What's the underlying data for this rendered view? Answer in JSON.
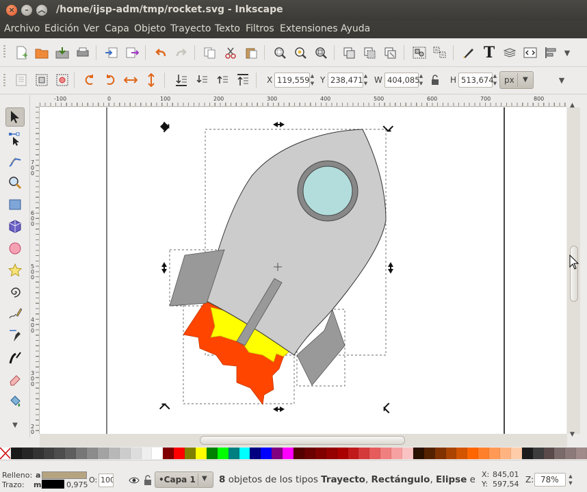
{
  "window": {
    "title": "/home/ijsp-adm/tmp/rocket.svg - Inkscape",
    "close_glyph": "×",
    "minimize_glyph": "–",
    "maximize_glyph": "︿"
  },
  "menu": [
    "Archivo",
    "Edición",
    "Ver",
    "Capa",
    "Objeto",
    "Trayecto",
    "Texto",
    "Filtros",
    "Extensiones",
    "Ayuda"
  ],
  "tool_controls": {
    "x_label": "X",
    "x_value": "119,559",
    "y_label": "Y",
    "y_value": "238,471",
    "w_label": "W",
    "w_value": "404,085",
    "h_label": "H",
    "h_value": "513,674",
    "unit": "px",
    "spin_up": "▲",
    "spin_down": "▼",
    "dropdown": "▼"
  },
  "rulers": {
    "h_labels": [
      "-100",
      "0",
      "100",
      "200",
      "300",
      "400",
      "500",
      "600",
      "700",
      "800"
    ],
    "v_labels": [
      "700",
      "600",
      "500",
      "400",
      "300",
      "200"
    ]
  },
  "palette_colors": [
    "#1a1a1a",
    "#262626",
    "#333333",
    "#404040",
    "#4d4d4d",
    "#5e5e5e",
    "#777777",
    "#8c8c8c",
    "#a3a3a3",
    "#b8b8b8",
    "#cccccc",
    "#dddddd",
    "#eeeeee",
    "#ffffff",
    "#800000",
    "#ff0000",
    "#808000",
    "#ffff00",
    "#008000",
    "#00ff00",
    "#008080",
    "#00ffff",
    "#000080",
    "#0000ff",
    "#800080",
    "#ff00ff",
    "#550000",
    "#6b0000",
    "#800000",
    "#950000",
    "#aa0000",
    "#c01a1a",
    "#d43a3a",
    "#e65c5c",
    "#f07f7f",
    "#f6a1a1",
    "#fac3c3",
    "#2b1100",
    "#552200",
    "#803300",
    "#aa4400",
    "#d45500",
    "#ff6600",
    "#ff7f2a",
    "#ff9955",
    "#ffb380",
    "#ffccaa",
    "#1c1c1c",
    "#3d3d3d",
    "#5a4a4a",
    "#7a6a6a",
    "#8c7a7a",
    "#a08a8a"
  ],
  "statusbar": {
    "fill_label": "Relleno:",
    "fill_value": "a",
    "fill_color": "#b6a481",
    "stroke_label": "Trazo:",
    "stroke_value": "m",
    "stroke_width": "0,975",
    "opacity_label": "O:",
    "opacity_value": "100",
    "layer": "•Capa 1",
    "message_count": "8",
    "message_text_a": " objetos de los tipos ",
    "message_type1": "Trayecto",
    "message_sep1": ", ",
    "message_type2": "Rectángulo",
    "message_sep2": ", ",
    "message_type3": "Elipse",
    "message_tail": " en",
    "coord_x_label": "X:",
    "coord_x": "845,01",
    "coord_y_label": "Y:",
    "coord_y": "597,54",
    "zoom_label": "Z:",
    "zoom_value": "78%"
  },
  "icons": {
    "new": "document-new-icon",
    "open": "folder-open-icon",
    "save": "save-icon",
    "print": "print-icon",
    "import": "import-icon",
    "export": "export-icon",
    "undo": "undo-icon",
    "redo": "redo-icon",
    "copy": "copy-icon",
    "cut": "cut-icon",
    "paste": "paste-icon",
    "zoom_selection": "zoom-selection-icon",
    "zoom_drawing": "zoom-drawing-icon",
    "zoom_page": "zoom-page-icon",
    "duplicate": "duplicate-icon",
    "clone": "clone-icon",
    "unlink_clone": "unlink-clone-icon",
    "group": "group-icon",
    "ungroup": "ungroup-icon",
    "fill_stroke": "fill-stroke-icon",
    "text": "text-icon",
    "layers": "layers-icon",
    "xml": "xml-editor-icon",
    "align": "align-icon"
  }
}
